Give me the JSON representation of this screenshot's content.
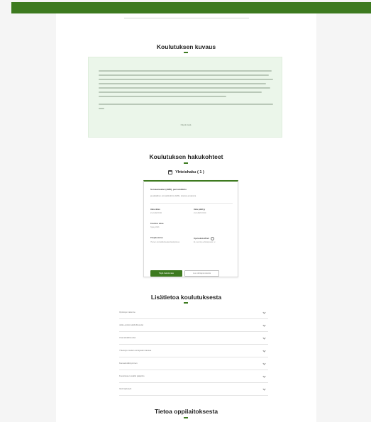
{
  "colors": {
    "brand": "#3d7a1f",
    "description_bg": "#ebf6ea",
    "page_bg": "#f5f5f5"
  },
  "description": {
    "title": "Koulutuksen kuvaus",
    "read_more": "Näytä lisää"
  },
  "hakukohteet": {
    "title": "Koulutuksen hakukohteet",
    "haku_label": "Yhteishaku ( 1 )",
    "card": {
      "title": "Sorvaamoalan (AMK), perustutkinto",
      "subtitle": "ja palkallinen ammattitutkinto (AMK), toteutus ja tarjonta",
      "haku_alkaa_label": "Haku alkaa",
      "haku_alkaa_value": "21.2.2023  8.00",
      "haku_paattyy_label": "Haku päättyy",
      "haku_paattyy_value": "21.3.2023  15.00",
      "koulutus_alkaa_label": "Koulutus alkaa",
      "koulutus_alkaa_value": "Syksy 2023",
      "pohjakoulutus_label": "Pohjakoulutus",
      "pohjakoulutus_value": "Yleinen ammattikorkeakoulukelpoisuus",
      "oppilaitos_label": "Opetuskielet/Kieli",
      "oppilaitos_value": "Et, suomi ja erikoisopetus, vi",
      "hae_button": "Täytä hakulomake",
      "secondary_button": "Lue valintaperusteista"
    }
  },
  "lisatietoa": {
    "title": "Lisätietoa koulutuksesta",
    "items": [
      "Opintojen rakenne",
      "Jatko-opintomahdollisuudet",
      "Uramahdollisuudet",
      "Yhteistyö muiden toimijoiden kanssa",
      "Kansainvälistyminen",
      "Koulutuksen sisältö pääpiirto",
      "Opinnäytetyöt"
    ]
  },
  "oppilaitos": {
    "title": "Tietoa oppilaitoksesta"
  }
}
